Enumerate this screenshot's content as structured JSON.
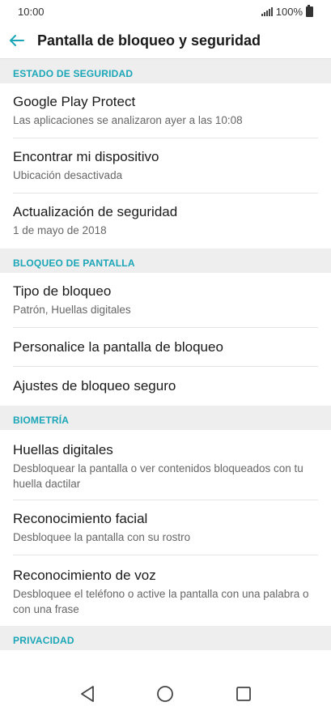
{
  "status_bar": {
    "time": "10:00",
    "battery": "100%"
  },
  "app_bar": {
    "title": "Pantalla de bloqueo y seguridad"
  },
  "sections": [
    {
      "header": "ESTADO DE SEGURIDAD",
      "items": [
        {
          "title": "Google Play Protect",
          "subtitle": "Las aplicaciones se analizaron ayer a las 10:08"
        },
        {
          "title": "Encontrar mi dispositivo",
          "subtitle": "Ubicación desactivada"
        },
        {
          "title": "Actualización de seguridad",
          "subtitle": "1 de mayo de 2018"
        }
      ]
    },
    {
      "header": "BLOQUEO DE PANTALLA",
      "items": [
        {
          "title": "Tipo de bloqueo",
          "subtitle": "Patrón, Huellas digitales"
        },
        {
          "title": "Personalice la pantalla de bloqueo"
        },
        {
          "title": "Ajustes de bloqueo seguro"
        }
      ]
    },
    {
      "header": "BIOMETRÍA",
      "items": [
        {
          "title": "Huellas digitales",
          "subtitle": "Desbloquear la pantalla o ver contenidos bloqueados con tu huella dactilar"
        },
        {
          "title": "Reconocimiento facial",
          "subtitle": "Desbloquee la pantalla con su rostro"
        },
        {
          "title": "Reconocimiento de voz",
          "subtitle": "Desbloquee el teléfono o active la pantalla con una palabra o con una frase"
        }
      ]
    },
    {
      "header": "PRIVACIDAD",
      "items": []
    }
  ],
  "icons": {
    "back": "arrow-left-icon",
    "nav_back": "triangle-back-icon",
    "nav_home": "circle-home-icon",
    "nav_recents": "square-recents-icon"
  },
  "colors": {
    "accent": "#1aa6b7",
    "section_bg": "#eeeeee"
  }
}
